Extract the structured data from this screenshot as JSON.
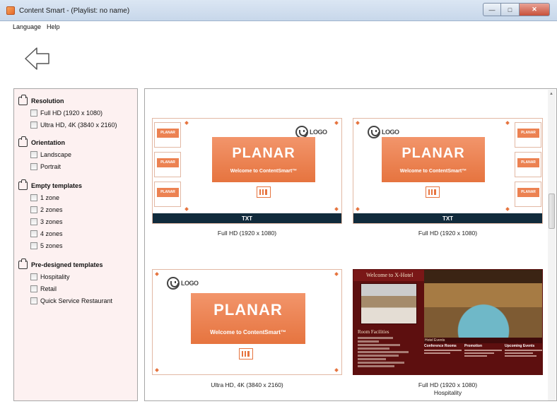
{
  "window": {
    "title": "Content Smart - (Playlist: no name)"
  },
  "menu": {
    "items": [
      "Language",
      "Help"
    ]
  },
  "filters": {
    "groups": [
      {
        "title": "Resolution",
        "options": [
          "Full HD (1920 x 1080)",
          "Ultra HD, 4K (3840 x 2160)"
        ]
      },
      {
        "title": "Orientation",
        "options": [
          "Landscape",
          "Portrait"
        ]
      },
      {
        "title": "Empty templates",
        "options": [
          "1 zone",
          "2 zones",
          "3 zones",
          "4 zones",
          "5 zones"
        ]
      },
      {
        "title": "Pre-designed templates",
        "options": [
          "Hospitality",
          "Retail",
          "Quick Service Restaurant"
        ]
      }
    ]
  },
  "templates": {
    "brand": "PLANAR",
    "welcome": "Welcome to ContentSmart™",
    "logo_text": "LOGO",
    "txt_label": "TXT",
    "mini_brand": "PLANAR",
    "tiles": [
      {
        "caption": "Full HD (1920 x 1080)",
        "caption2": ""
      },
      {
        "caption": "Full HD (1920 x 1080)",
        "caption2": ""
      },
      {
        "caption": "Ultra HD, 4K (3840 x 2160)",
        "caption2": ""
      },
      {
        "caption": "Full HD (1920 x 1080)",
        "caption2": "Hospitality"
      }
    ],
    "hotel": {
      "title": "Welcome to X-Hotel",
      "facilities": "Room Facilities",
      "events": "Hotel Events",
      "columns": [
        "Conference Rooms",
        "Promotion",
        "Upcoming Events"
      ]
    }
  },
  "colors": {
    "accent": "#e6743f",
    "panel_bg": "#fdf1f1",
    "txt_bar": "#112b3c",
    "hotel_bg": "#5d0f0f"
  }
}
